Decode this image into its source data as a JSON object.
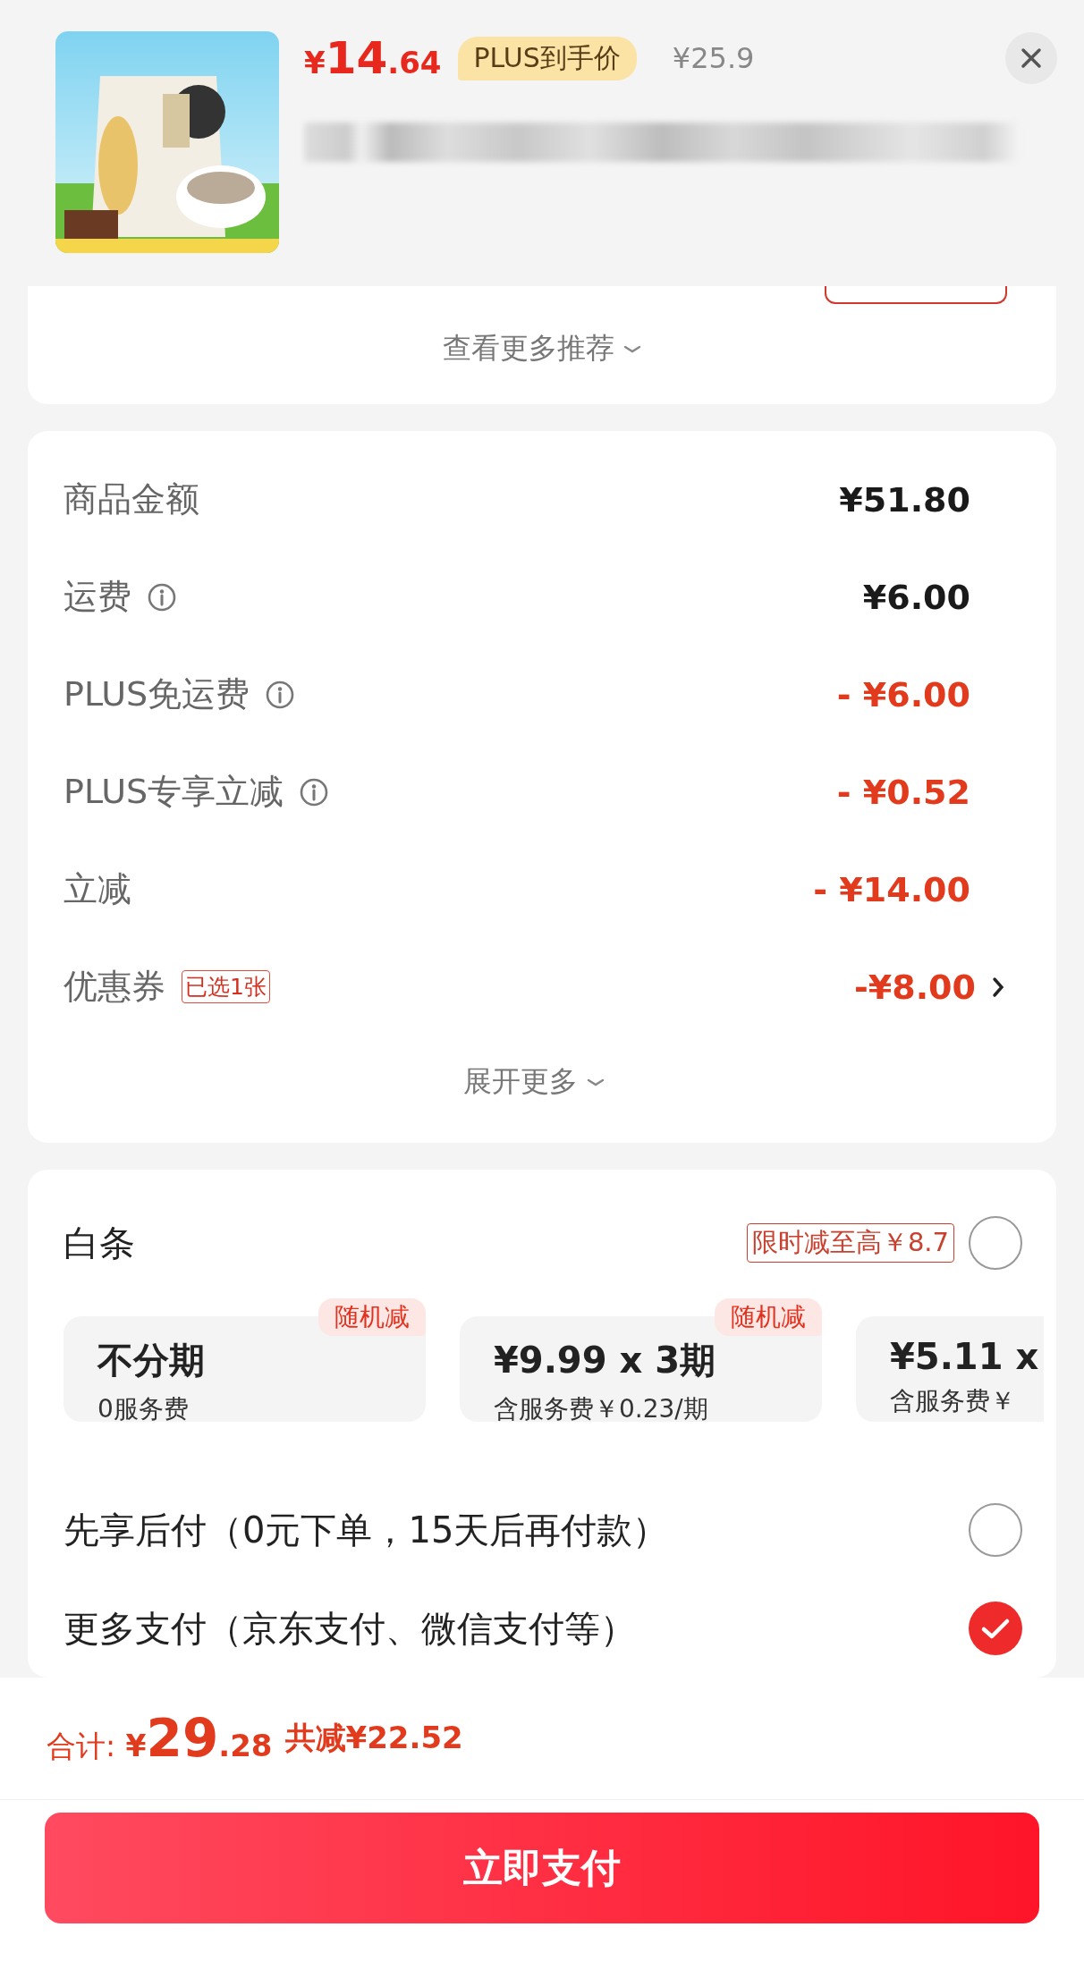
{
  "product": {
    "price": {
      "currency": "¥",
      "integer": "14",
      "decimal": ".64"
    },
    "plus_badge": "PLUS到手价",
    "original_price": "¥25.9",
    "title_blurred": true
  },
  "recommendations": {
    "more_link": "查看更多推荐"
  },
  "summary": {
    "rows": [
      {
        "label": "商品金额",
        "info": false,
        "amount": "¥51.80",
        "kind": "plain"
      },
      {
        "label": "运费",
        "info": true,
        "amount": "¥6.00",
        "kind": "plain"
      },
      {
        "label": "PLUS免运费",
        "info": true,
        "amount": "- ¥6.00",
        "kind": "discount"
      },
      {
        "label": "PLUS专享立减",
        "info": true,
        "amount": "- ¥0.52",
        "kind": "discount"
      },
      {
        "label": "立减",
        "info": false,
        "amount": "- ¥14.00",
        "kind": "discount"
      },
      {
        "label": "优惠券",
        "info": false,
        "tag": "已选1张",
        "amount": "-¥8.00",
        "kind": "discount",
        "has_arrow": true
      }
    ],
    "expand_link": "展开更多"
  },
  "payment": {
    "baitiao": {
      "label": "白条",
      "promo": "限时减至高￥8.7",
      "selected": false,
      "plans": [
        {
          "title": "不分期",
          "subtitle": "0服务费",
          "tag": "随机减"
        },
        {
          "title": "¥9.99 x 3期",
          "subtitle": "含服务费￥0.23/期",
          "tag": "随机减"
        },
        {
          "title": "¥5.11 x",
          "subtitle": "含服务费￥"
        }
      ]
    },
    "options": [
      {
        "label": "先享后付（0元下单，15天后再付款）",
        "selected": false
      },
      {
        "label": "更多支付（京东支付、微信支付等）",
        "selected": true
      }
    ]
  },
  "footer": {
    "total_label": "合计:",
    "total_currency": "¥",
    "total_integer": "29",
    "total_decimal": ".28",
    "saved": "共减¥22.52",
    "pay_button": "立即支付"
  }
}
